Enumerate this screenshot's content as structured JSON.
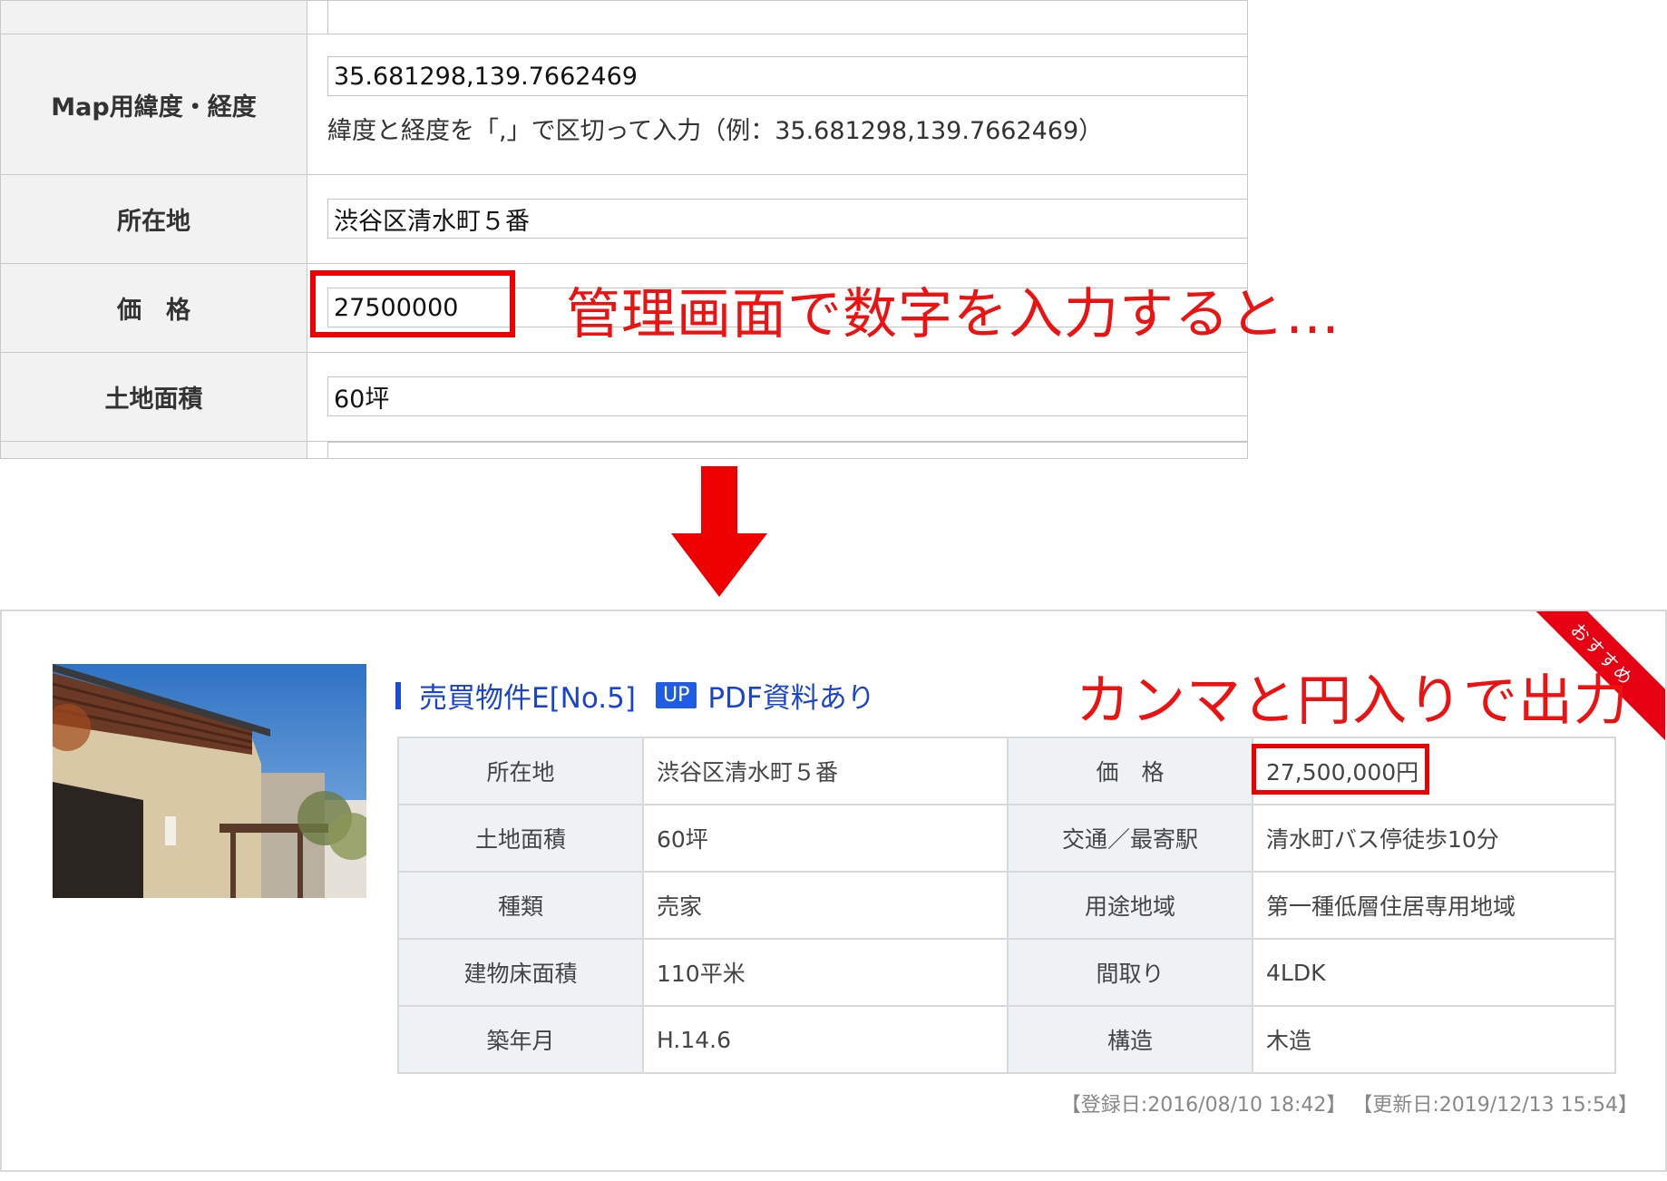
{
  "admin": {
    "rows": [
      {
        "label": "",
        "value": ""
      },
      {
        "label": "Map用緯度・経度",
        "value": "35.681298,139.7662469",
        "note": "緯度と経度を「,」で区切って入力（例：35.681298,139.7662469）"
      },
      {
        "label": "所在地",
        "value": "渋谷区清水町５番"
      },
      {
        "label": "価　格",
        "value": "27500000"
      },
      {
        "label": "土地面積",
        "value": "60坪"
      },
      {
        "label": "",
        "value": ""
      }
    ],
    "callout": "管理画面で数字を入力すると…"
  },
  "arrow_color": "#ee0000",
  "listing": {
    "ribbon": "おすすめ",
    "title": "売買物件E[No.5]",
    "badge": "UP",
    "pdf_label": "PDF資料あり",
    "callout": "カンマと円入りで出力",
    "photo_alt": "building-photo",
    "specs": [
      {
        "label1": "所在地",
        "value1": "渋谷区清水町５番",
        "label2": "価　格",
        "value2": "27,500,000円"
      },
      {
        "label1": "土地面積",
        "value1": "60坪",
        "label2": "交通／最寄駅",
        "value2": "清水町バス停徒歩10分"
      },
      {
        "label1": "種類",
        "value1": "売家",
        "label2": "用途地域",
        "value2": "第一種低層住居専用地域"
      },
      {
        "label1": "建物床面積",
        "value1": "110平米",
        "label2": "間取り",
        "value2": "4LDK"
      },
      {
        "label1": "築年月",
        "value1": "H.14.6",
        "label2": "構造",
        "value2": "木造"
      }
    ],
    "registered": "【登録日:2016/08/10 18:42】",
    "updated": "【更新日:2019/12/13 15:54】"
  },
  "colors": {
    "accent_red": "#ee0000",
    "title_blue": "#1a44d0",
    "badge_blue": "#1f5ce6",
    "ribbon_red": "#e60012"
  }
}
